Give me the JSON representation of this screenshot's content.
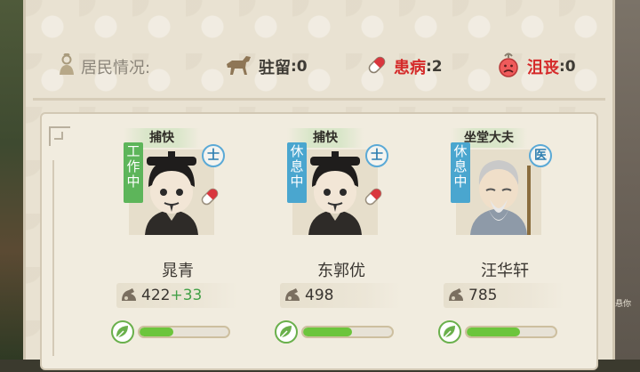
{
  "status": {
    "residents_label": "居民情况:",
    "stationed_label": "驻留",
    "stationed_count": ":0",
    "sick_label": "患病",
    "sick_count": ":2",
    "depressed_label": "沮丧",
    "depressed_count": ":0"
  },
  "residents": [
    {
      "job": "捕快",
      "state": "工作中",
      "state_type": "work",
      "rank": "士",
      "sick": true,
      "name": "晁青",
      "stat": "422",
      "stat_bonus": "+33",
      "energy_fraction": 0.38
    },
    {
      "job": "捕快",
      "state": "休息中",
      "state_type": "rest",
      "rank": "士",
      "sick": true,
      "name": "东郭优",
      "stat": "498",
      "stat_bonus": "",
      "energy_fraction": 0.55
    },
    {
      "job": "坐堂大夫",
      "state": "休息中",
      "state_type": "rest",
      "rank": "医",
      "sick": false,
      "name": "汪华轩",
      "stat": "785",
      "stat_bonus": "",
      "energy_fraction": 0.6
    }
  ],
  "colors": {
    "work_tag": "#5db55a",
    "rest_tag": "#4aa6cf",
    "bar_fill": "#6cc53c",
    "alert_red": "#d52a2a"
  },
  "icons": {
    "residents": "person-icon",
    "stationed": "horse-icon",
    "sick": "pill-icon",
    "depressed": "sad-face-icon",
    "stat": "strength-icon",
    "energy": "leaf-icon"
  }
}
